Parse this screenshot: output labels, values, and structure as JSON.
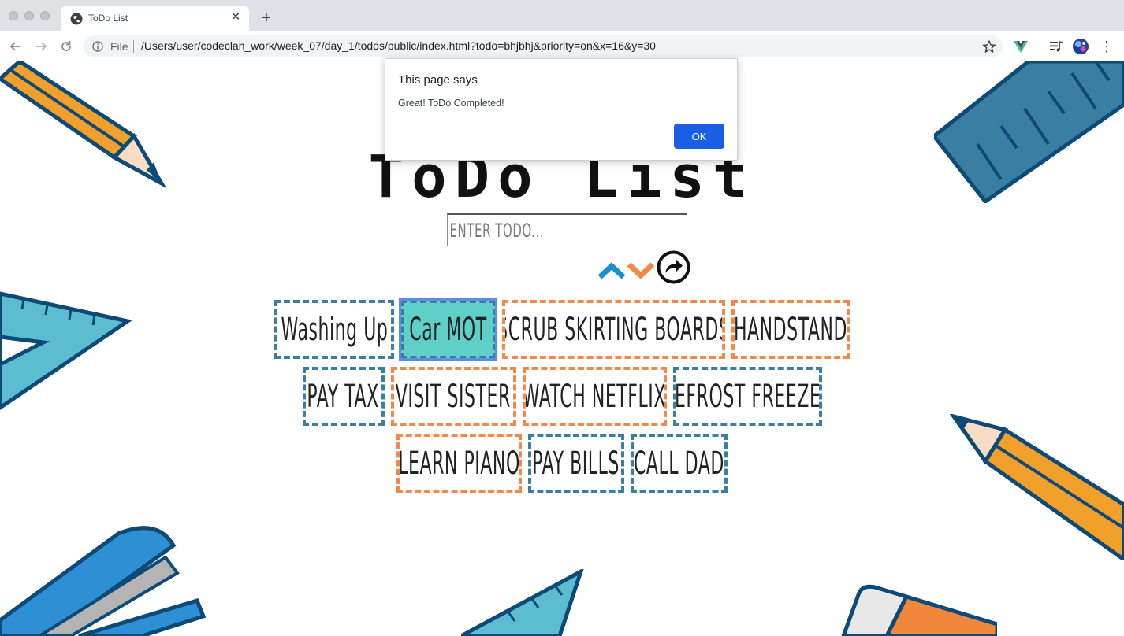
{
  "browser": {
    "tab": {
      "title": "ToDo List"
    },
    "new_tab_label": "+",
    "omnibox": {
      "scheme": "File",
      "url": "/Users/user/codeclan_work/week_07/day_1/todos/public/index.html?todo=bhjbhj&priority=on&x=16&y=30"
    }
  },
  "app": {
    "title": "ToDo List",
    "input": {
      "placeholder": "Enter ToDo...",
      "value": ""
    },
    "todos": [
      {
        "text": "Washing Up",
        "color": "#3a7ea1"
      },
      {
        "text": "Car MOT",
        "color": "#3a7ea1",
        "selected": true,
        "fill": "#5fcfc8"
      },
      {
        "text": "SCRUB SKIRTING BOARDS",
        "color": "#f0894a"
      },
      {
        "text": "HANDSTAND",
        "color": "#f0894a"
      },
      {
        "text": "PAY TAX",
        "color": "#3a7ea1"
      },
      {
        "text": "VISIT SISTER",
        "color": "#f0894a"
      },
      {
        "text": "WATCH NETFLIX",
        "color": "#f0894a"
      },
      {
        "text": "DEFROST FREEZER",
        "color": "#3a7ea1"
      },
      {
        "text": "LEARN PIANO",
        "color": "#f0894a"
      },
      {
        "text": "PAY BILLS",
        "color": "#3a7ea1"
      },
      {
        "text": "CALL DAD",
        "color": "#3a7ea1"
      }
    ],
    "accent_blue": "#1a8fd0",
    "accent_orange": "#f0894a"
  },
  "dialog": {
    "title": "This page says",
    "message": "Great! ToDo Completed!",
    "ok_label": "OK",
    "ok_color": "#1a5fe3"
  }
}
